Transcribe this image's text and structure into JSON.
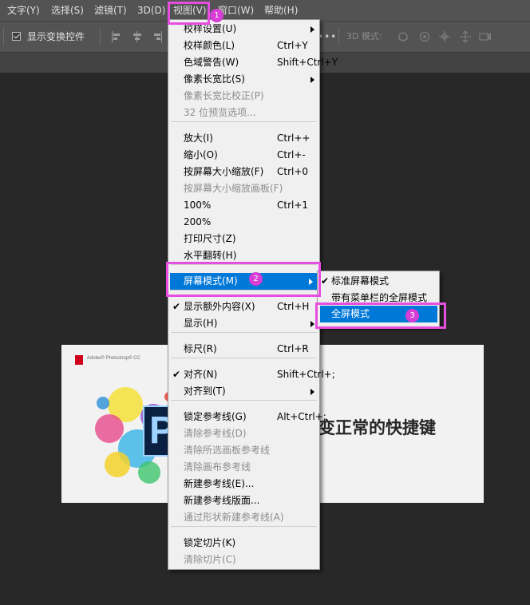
{
  "menubar": {
    "items": [
      "文字(Y)",
      "选择(S)",
      "滤镜(T)",
      "3D(D)",
      "视图(V)",
      "窗口(W)",
      "帮助(H)"
    ]
  },
  "options_bar": {
    "show_transform_label": "显示变换控件",
    "more_dots": "•••",
    "mode_3d_label": "3D 模式:"
  },
  "view_menu": {
    "items": [
      {
        "label": "校样设置(U)",
        "shortcut": "",
        "submenu": true,
        "disabled": false
      },
      {
        "label": "校样颜色(L)",
        "shortcut": "Ctrl+Y",
        "submenu": false,
        "disabled": false
      },
      {
        "label": "色域警告(W)",
        "shortcut": "Shift+Ctrl+Y",
        "submenu": false,
        "disabled": false
      },
      {
        "label": "像素长宽比(S)",
        "shortcut": "",
        "submenu": true,
        "disabled": false
      },
      {
        "label": "像素长宽比校正(P)",
        "shortcut": "",
        "submenu": false,
        "disabled": true
      },
      {
        "label": "32 位预览选项...",
        "shortcut": "",
        "submenu": false,
        "disabled": true
      },
      {
        "label": "放大(I)",
        "shortcut": "Ctrl++",
        "submenu": false,
        "disabled": false
      },
      {
        "label": "缩小(O)",
        "shortcut": "Ctrl+-",
        "submenu": false,
        "disabled": false
      },
      {
        "label": "按屏幕大小缩放(F)",
        "shortcut": "Ctrl+0",
        "submenu": false,
        "disabled": false
      },
      {
        "label": "按屏幕大小缩放画板(F)",
        "shortcut": "",
        "submenu": false,
        "disabled": true
      },
      {
        "label": "100%",
        "shortcut": "Ctrl+1",
        "submenu": false,
        "disabled": false
      },
      {
        "label": "200%",
        "shortcut": "",
        "submenu": false,
        "disabled": false
      },
      {
        "label": "打印尺寸(Z)",
        "shortcut": "",
        "submenu": false,
        "disabled": false
      },
      {
        "label": "水平翻转(H)",
        "shortcut": "",
        "submenu": false,
        "disabled": false
      },
      {
        "label": "屏幕模式(M)",
        "shortcut": "",
        "submenu": true,
        "disabled": false,
        "highlighted": true
      },
      {
        "label": "显示额外内容(X)",
        "shortcut": "Ctrl+H",
        "submenu": false,
        "disabled": false,
        "checked": true
      },
      {
        "label": "显示(H)",
        "shortcut": "",
        "submenu": true,
        "disabled": false
      },
      {
        "label": "标尺(R)",
        "shortcut": "Ctrl+R",
        "submenu": false,
        "disabled": false
      },
      {
        "label": "对齐(N)",
        "shortcut": "Shift+Ctrl+;",
        "submenu": false,
        "disabled": false,
        "checked": true
      },
      {
        "label": "对齐到(T)",
        "shortcut": "",
        "submenu": true,
        "disabled": false
      },
      {
        "label": "锁定参考线(G)",
        "shortcut": "Alt+Ctrl+;",
        "submenu": false,
        "disabled": false
      },
      {
        "label": "清除参考线(D)",
        "shortcut": "",
        "submenu": false,
        "disabled": true
      },
      {
        "label": "清除所选画板参考线",
        "shortcut": "",
        "submenu": false,
        "disabled": true
      },
      {
        "label": "清除画布参考线",
        "shortcut": "",
        "submenu": false,
        "disabled": true
      },
      {
        "label": "新建参考线(E)...",
        "shortcut": "",
        "submenu": false,
        "disabled": false
      },
      {
        "label": "新建参考线版面...",
        "shortcut": "",
        "submenu": false,
        "disabled": false
      },
      {
        "label": "通过形状新建参考线(A)",
        "shortcut": "",
        "submenu": false,
        "disabled": true
      },
      {
        "label": "锁定切片(K)",
        "shortcut": "",
        "submenu": false,
        "disabled": false
      },
      {
        "label": "清除切片(C)",
        "shortcut": "",
        "submenu": false,
        "disabled": true
      }
    ]
  },
  "screen_mode_submenu": {
    "items": [
      {
        "label": "标准屏幕模式",
        "checked": true
      },
      {
        "label": "带有菜单栏的全屏模式",
        "checked": false
      },
      {
        "label": "全屏模式",
        "checked": false,
        "highlighted": true
      }
    ]
  },
  "document": {
    "brand_text": "Adobe® Photoshop® CC",
    "ps_logo_text": "P",
    "headline": "变正常的快捷键"
  },
  "annotations": {
    "badges": [
      "1",
      "2",
      "3"
    ],
    "highlight_color": "#e64ee0"
  },
  "colors": {
    "menubar_bg": "#535353",
    "workspace_bg": "#282828",
    "menu_bg": "#f0f0f0",
    "highlight_bg": "#0078d7",
    "disabled_text": "#8d8d8d"
  }
}
